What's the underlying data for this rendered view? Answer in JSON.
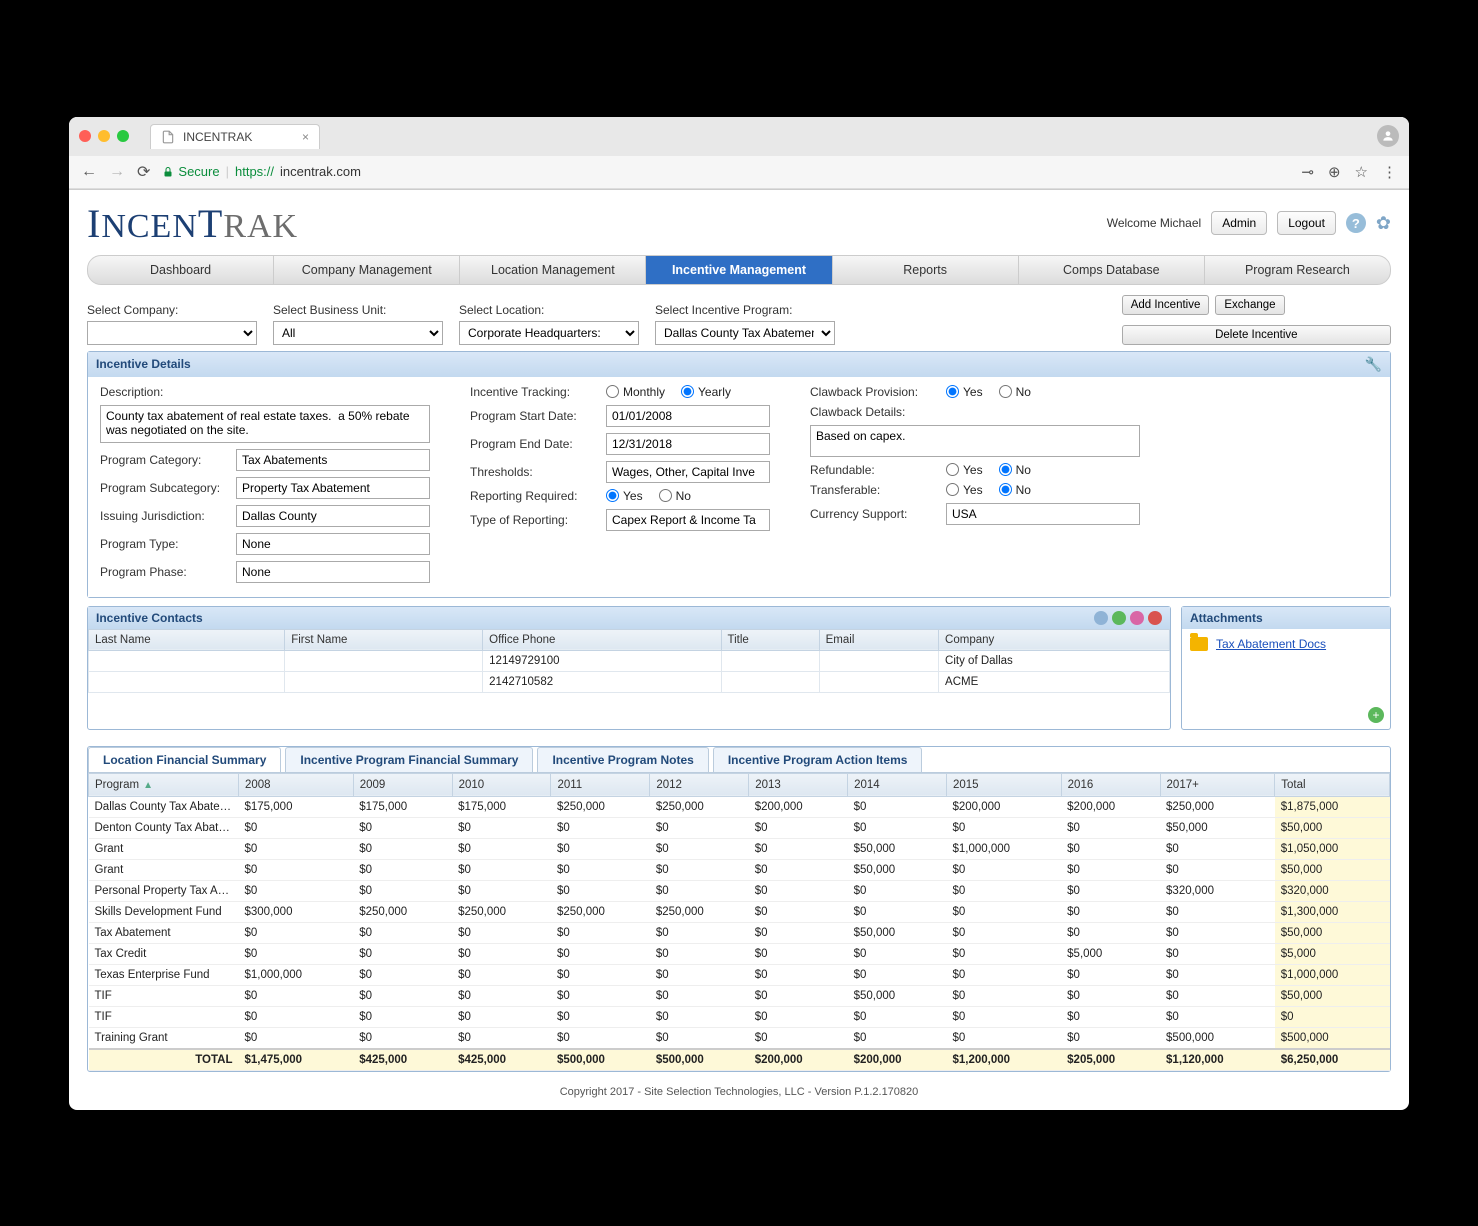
{
  "browser": {
    "tab_title": "INCENTRAK",
    "secure_label": "Secure",
    "url_protocol": "https://",
    "url_host": "incentrak.com"
  },
  "header": {
    "welcome": "Welcome Michael",
    "admin_btn": "Admin",
    "logout_btn": "Logout"
  },
  "nav": {
    "tabs": [
      "Dashboard",
      "Company Management",
      "Location Management",
      "Incentive Management",
      "Reports",
      "Comps Database",
      "Program Research"
    ],
    "active_index": 3
  },
  "filters": {
    "company_label": "Select Company:",
    "company_value": "",
    "bu_label": "Select Business Unit:",
    "bu_value": "All",
    "location_label": "Select Location:",
    "location_value": "Corporate Headquarters:",
    "program_label": "Select Incentive Program:",
    "program_value": "Dallas County Tax Abatement",
    "buttons": {
      "add": "Add Incentive",
      "exchange": "Exchange",
      "delete": "Delete Incentive"
    }
  },
  "details": {
    "panel_title": "Incentive Details",
    "description_label": "Description:",
    "description_value": "County tax abatement of real estate taxes.  a 50% rebate was negotiated on the site.",
    "category_label": "Program Category:",
    "category_value": "Tax Abatements",
    "subcategory_label": "Program Subcategory:",
    "subcategory_value": "Property Tax Abatement",
    "jurisdiction_label": "Issuing Jurisdiction:",
    "jurisdiction_value": "Dallas County",
    "ptype_label": "Program Type:",
    "ptype_value": "None",
    "pphase_label": "Program Phase:",
    "pphase_value": "None",
    "tracking_label": "Incentive Tracking:",
    "tracking_monthly": "Monthly",
    "tracking_yearly": "Yearly",
    "start_label": "Program Start Date:",
    "start_value": "01/01/2008",
    "end_label": "Program End Date:",
    "end_value": "12/31/2018",
    "thresholds_label": "Thresholds:",
    "thresholds_value": "Wages, Other, Capital Inve",
    "reportreq_label": "Reporting Required:",
    "reporttype_label": "Type of Reporting:",
    "reporttype_value": "Capex Report & Income Ta",
    "clawback_label": "Clawback Provision:",
    "clawback_details_label": "Clawback Details:",
    "clawback_details_value": "Based on capex.",
    "refundable_label": "Refundable:",
    "transferable_label": "Transferable:",
    "currency_label": "Currency Support:",
    "currency_value": "USA",
    "yes": "Yes",
    "no": "No"
  },
  "contacts": {
    "panel_title": "Incentive Contacts",
    "headers": [
      "Last Name",
      "First Name",
      "Office Phone",
      "Title",
      "Email",
      "Company"
    ],
    "rows": [
      {
        "last": "",
        "first": "",
        "phone": "12149729100",
        "title": "",
        "email": "",
        "company": "City of Dallas"
      },
      {
        "last": "",
        "first": "",
        "phone": "2142710582",
        "title": "",
        "email": "",
        "company": "ACME"
      }
    ]
  },
  "attachments": {
    "panel_title": "Attachments",
    "link": "Tax Abatement Docs"
  },
  "subtabs": {
    "items": [
      "Location Financial Summary",
      "Incentive Program Financial Summary",
      "Incentive Program Notes",
      "Incentive Program Action Items"
    ],
    "active_index": 0
  },
  "fin": {
    "program_header": "Program",
    "years": [
      "2008",
      "2009",
      "2010",
      "2011",
      "2012",
      "2013",
      "2014",
      "2015",
      "2016",
      "2017+"
    ],
    "total_header": "Total",
    "rows": [
      {
        "name": "Dallas County Tax Abatement",
        "v": [
          "$175,000",
          "$175,000",
          "$175,000",
          "$250,000",
          "$250,000",
          "$200,000",
          "$0",
          "$200,000",
          "$200,000",
          "$250,000"
        ],
        "total": "$1,875,000"
      },
      {
        "name": "Denton County Tax Abateme…",
        "v": [
          "$0",
          "$0",
          "$0",
          "$0",
          "$0",
          "$0",
          "$0",
          "$0",
          "$0",
          "$50,000"
        ],
        "total": "$50,000"
      },
      {
        "name": "Grant",
        "v": [
          "$0",
          "$0",
          "$0",
          "$0",
          "$0",
          "$0",
          "$50,000",
          "$1,000,000",
          "$0",
          "$0"
        ],
        "total": "$1,050,000"
      },
      {
        "name": "Grant",
        "v": [
          "$0",
          "$0",
          "$0",
          "$0",
          "$0",
          "$0",
          "$50,000",
          "$0",
          "$0",
          "$0"
        ],
        "total": "$50,000"
      },
      {
        "name": "Personal Property Tax Abate…",
        "v": [
          "$0",
          "$0",
          "$0",
          "$0",
          "$0",
          "$0",
          "$0",
          "$0",
          "$0",
          "$320,000"
        ],
        "total": "$320,000"
      },
      {
        "name": "Skills Development Fund",
        "v": [
          "$300,000",
          "$250,000",
          "$250,000",
          "$250,000",
          "$250,000",
          "$0",
          "$0",
          "$0",
          "$0",
          "$0"
        ],
        "total": "$1,300,000"
      },
      {
        "name": "Tax Abatement",
        "v": [
          "$0",
          "$0",
          "$0",
          "$0",
          "$0",
          "$0",
          "$50,000",
          "$0",
          "$0",
          "$0"
        ],
        "total": "$50,000"
      },
      {
        "name": "Tax Credit",
        "v": [
          "$0",
          "$0",
          "$0",
          "$0",
          "$0",
          "$0",
          "$0",
          "$0",
          "$5,000",
          "$0"
        ],
        "total": "$5,000"
      },
      {
        "name": "Texas Enterprise Fund",
        "v": [
          "$1,000,000",
          "$0",
          "$0",
          "$0",
          "$0",
          "$0",
          "$0",
          "$0",
          "$0",
          "$0"
        ],
        "total": "$1,000,000"
      },
      {
        "name": "TIF",
        "v": [
          "$0",
          "$0",
          "$0",
          "$0",
          "$0",
          "$0",
          "$50,000",
          "$0",
          "$0",
          "$0"
        ],
        "total": "$50,000"
      },
      {
        "name": "TIF",
        "v": [
          "$0",
          "$0",
          "$0",
          "$0",
          "$0",
          "$0",
          "$0",
          "$0",
          "$0",
          "$0"
        ],
        "total": "$0"
      },
      {
        "name": "Training Grant",
        "v": [
          "$0",
          "$0",
          "$0",
          "$0",
          "$0",
          "$0",
          "$0",
          "$0",
          "$0",
          "$500,000"
        ],
        "total": "$500,000"
      }
    ],
    "total_label": "TOTAL",
    "totals": [
      "$1,475,000",
      "$425,000",
      "$425,000",
      "$500,000",
      "$500,000",
      "$200,000",
      "$200,000",
      "$1,200,000",
      "$205,000",
      "$1,120,000"
    ],
    "grand_total": "$6,250,000"
  },
  "footer": "Copyright 2017 - Site Selection Technologies, LLC - Version P.1.2.170820"
}
